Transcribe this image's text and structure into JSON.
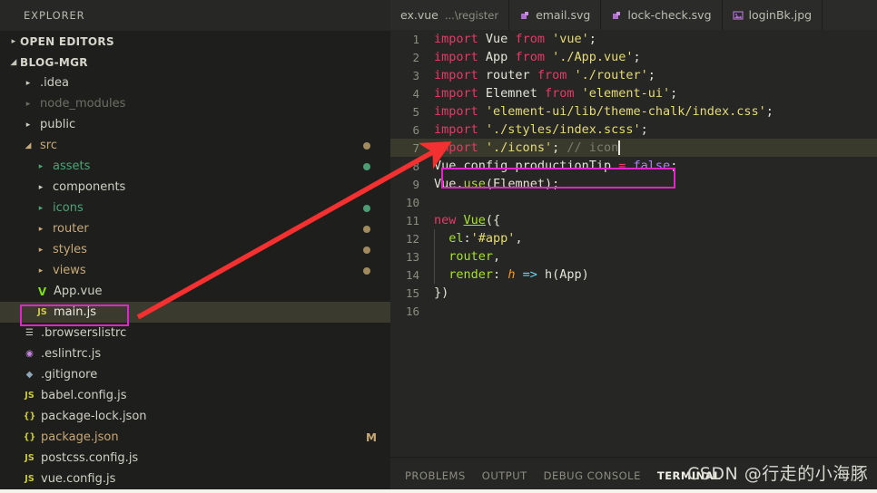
{
  "sidebar": {
    "title": "EXPLORER",
    "sections": [
      {
        "label": "OPEN EDITORS",
        "expanded": false
      },
      {
        "label": "BLOG-MGR",
        "expanded": true
      }
    ],
    "tree": [
      {
        "label": ".idea",
        "icon": "folder-collapsed-icon",
        "icon_glyph": "▸",
        "kind": "folder",
        "indent": 1,
        "color": "#cfcfc4",
        "dot": "",
        "badge": ""
      },
      {
        "label": "node_modules",
        "icon": "folder-collapsed-icon",
        "icon_glyph": "▸",
        "kind": "folder",
        "indent": 1,
        "color": "#6e6e64",
        "dot": "",
        "badge": ""
      },
      {
        "label": "public",
        "icon": "folder-collapsed-icon",
        "icon_glyph": "▸",
        "kind": "folder",
        "indent": 1,
        "color": "#cfcfc4",
        "dot": "",
        "badge": ""
      },
      {
        "label": "src",
        "icon": "folder-expanded-icon",
        "icon_glyph": "◢",
        "kind": "folder",
        "indent": 1,
        "color": "#c8a977",
        "dot": "#a08a5e",
        "badge": ""
      },
      {
        "label": "assets",
        "icon": "folder-collapsed-icon",
        "icon_glyph": "▸",
        "kind": "folder",
        "indent": 2,
        "color": "#4ea377",
        "dot": "#4d9d74",
        "badge": ""
      },
      {
        "label": "components",
        "icon": "folder-collapsed-icon",
        "icon_glyph": "▸",
        "kind": "folder",
        "indent": 2,
        "color": "#cfcfc4",
        "dot": "",
        "badge": ""
      },
      {
        "label": "icons",
        "icon": "folder-collapsed-icon",
        "icon_glyph": "▸",
        "kind": "folder",
        "indent": 2,
        "color": "#4ea377",
        "dot": "#4d9d74",
        "badge": ""
      },
      {
        "label": "router",
        "icon": "folder-collapsed-icon",
        "icon_glyph": "▸",
        "kind": "folder",
        "indent": 2,
        "color": "#c8a977",
        "dot": "#a08a5e",
        "badge": ""
      },
      {
        "label": "styles",
        "icon": "folder-collapsed-icon",
        "icon_glyph": "▸",
        "kind": "folder",
        "indent": 2,
        "color": "#c8a977",
        "dot": "#a08a5e",
        "badge": ""
      },
      {
        "label": "views",
        "icon": "folder-collapsed-icon",
        "icon_glyph": "▸",
        "kind": "folder",
        "indent": 2,
        "color": "#c8a977",
        "dot": "#a08a5e",
        "badge": ""
      },
      {
        "label": "App.vue",
        "icon": "vue-file-icon",
        "icon_glyph": "V",
        "kind": "file",
        "indent": 2,
        "color": "#cfcfc4",
        "dot": "",
        "badge": "",
        "icon_color": "#7ddc1f"
      },
      {
        "label": "main.js",
        "icon": "js-file-icon",
        "icon_glyph": "JS",
        "kind": "file",
        "indent": 2,
        "color": "#e8e8e0",
        "dot": "",
        "badge": "",
        "icon_color": "#cbcb41",
        "selected": true
      },
      {
        "label": ".browserslistrc",
        "icon": "config-file-icon",
        "icon_glyph": "☰",
        "kind": "file",
        "indent": 1,
        "color": "#cfcfc4",
        "dot": "",
        "badge": "",
        "icon_color": "#d4d4c8"
      },
      {
        "label": ".eslintrc.js",
        "icon": "eslint-file-icon",
        "icon_glyph": "◉",
        "kind": "file",
        "indent": 1,
        "color": "#cfcfc4",
        "dot": "",
        "badge": "",
        "icon_color": "#c586e0"
      },
      {
        "label": ".gitignore",
        "icon": "git-file-icon",
        "icon_glyph": "◆",
        "kind": "file",
        "indent": 1,
        "color": "#cfcfc4",
        "dot": "",
        "badge": "",
        "icon_color": "#8fa6b5"
      },
      {
        "label": "babel.config.js",
        "icon": "js-file-icon",
        "icon_glyph": "JS",
        "kind": "file",
        "indent": 1,
        "color": "#cfcfc4",
        "dot": "",
        "badge": "",
        "icon_color": "#cbcb41"
      },
      {
        "label": "package-lock.json",
        "icon": "json-file-icon",
        "icon_glyph": "{}",
        "kind": "file",
        "indent": 1,
        "color": "#cfcfc4",
        "dot": "",
        "badge": "",
        "icon_color": "#cbcb41"
      },
      {
        "label": "package.json",
        "icon": "json-file-icon",
        "icon_glyph": "{}",
        "kind": "file",
        "indent": 1,
        "color": "#c8a977",
        "dot": "",
        "badge": "M",
        "badge_color": "#c8a977",
        "icon_color": "#cbcb41"
      },
      {
        "label": "postcss.config.js",
        "icon": "js-file-icon",
        "icon_glyph": "JS",
        "kind": "file",
        "indent": 1,
        "color": "#cfcfc4",
        "dot": "",
        "badge": "",
        "icon_color": "#cbcb41"
      },
      {
        "label": "vue.config.js",
        "icon": "js-file-icon",
        "icon_glyph": "JS",
        "kind": "file",
        "indent": 1,
        "color": "#cfcfc4",
        "dot": "",
        "badge": "",
        "icon_color": "#cbcb41"
      }
    ]
  },
  "tabs": [
    {
      "label": "ex.vue",
      "desc": "...\\register",
      "icon": "vue-file-icon",
      "icon_glyph": "",
      "active": false
    },
    {
      "label": "email.svg",
      "desc": "",
      "icon": "svg-file-icon",
      "icon_glyph": "",
      "active": false
    },
    {
      "label": "lock-check.svg",
      "desc": "",
      "icon": "svg-file-icon",
      "icon_glyph": "",
      "active": false
    },
    {
      "label": "loginBk.jpg",
      "desc": "",
      "icon": "image-file-icon",
      "icon_glyph": "",
      "active": false
    }
  ],
  "code": {
    "lines": [
      {
        "n": "1",
        "tokens": [
          {
            "t": "kw",
            "v": "import"
          },
          {
            "t": "plain",
            "v": " "
          },
          {
            "t": "var",
            "v": "Vue"
          },
          {
            "t": "plain",
            "v": " "
          },
          {
            "t": "kw",
            "v": "from"
          },
          {
            "t": "plain",
            "v": " "
          },
          {
            "t": "str",
            "v": "'vue'"
          },
          {
            "t": "plain",
            "v": ";"
          }
        ]
      },
      {
        "n": "2",
        "tokens": [
          {
            "t": "kw",
            "v": "import"
          },
          {
            "t": "plain",
            "v": " "
          },
          {
            "t": "var",
            "v": "App"
          },
          {
            "t": "plain",
            "v": " "
          },
          {
            "t": "kw",
            "v": "from"
          },
          {
            "t": "plain",
            "v": " "
          },
          {
            "t": "str",
            "v": "'./App.vue'"
          },
          {
            "t": "plain",
            "v": ";"
          }
        ]
      },
      {
        "n": "3",
        "tokens": [
          {
            "t": "kw",
            "v": "import"
          },
          {
            "t": "plain",
            "v": " "
          },
          {
            "t": "var",
            "v": "router"
          },
          {
            "t": "plain",
            "v": " "
          },
          {
            "t": "kw",
            "v": "from"
          },
          {
            "t": "plain",
            "v": " "
          },
          {
            "t": "str",
            "v": "'./router'"
          },
          {
            "t": "plain",
            "v": ";"
          }
        ]
      },
      {
        "n": "4",
        "tokens": [
          {
            "t": "kw",
            "v": "import"
          },
          {
            "t": "plain",
            "v": " "
          },
          {
            "t": "var",
            "v": "Elemnet"
          },
          {
            "t": "plain",
            "v": " "
          },
          {
            "t": "kw",
            "v": "from"
          },
          {
            "t": "plain",
            "v": " "
          },
          {
            "t": "str",
            "v": "'element-ui'"
          },
          {
            "t": "plain",
            "v": ";"
          }
        ]
      },
      {
        "n": "5",
        "tokens": [
          {
            "t": "kw",
            "v": "import"
          },
          {
            "t": "plain",
            "v": " "
          },
          {
            "t": "str",
            "v": "'element-ui/lib/theme-chalk/index.css'"
          },
          {
            "t": "plain",
            "v": ";"
          }
        ]
      },
      {
        "n": "6",
        "tokens": [
          {
            "t": "kw",
            "v": "import"
          },
          {
            "t": "plain",
            "v": " "
          },
          {
            "t": "str",
            "v": "'./styles/index.scss'"
          },
          {
            "t": "plain",
            "v": ";"
          }
        ]
      },
      {
        "n": "7",
        "tokens": [
          {
            "t": "kw",
            "v": "import"
          },
          {
            "t": "plain",
            "v": " "
          },
          {
            "t": "str",
            "v": "'./icons'"
          },
          {
            "t": "plain",
            "v": "; "
          },
          {
            "t": "com",
            "v": "// icon"
          }
        ],
        "active": true,
        "cursor": true
      },
      {
        "n": "8",
        "tokens": [
          {
            "t": "var",
            "v": "Vue"
          },
          {
            "t": "plain",
            "v": "."
          },
          {
            "t": "var",
            "v": "config"
          },
          {
            "t": "plain",
            "v": "."
          },
          {
            "t": "var",
            "v": "productionTip"
          },
          {
            "t": "plain",
            "v": " "
          },
          {
            "t": "op",
            "v": "="
          },
          {
            "t": "plain",
            "v": " "
          },
          {
            "t": "num",
            "v": "false"
          },
          {
            "t": "plain",
            "v": ";"
          }
        ]
      },
      {
        "n": "9",
        "tokens": [
          {
            "t": "var",
            "v": "Vue"
          },
          {
            "t": "plain",
            "v": "."
          },
          {
            "t": "fn",
            "v": "use"
          },
          {
            "t": "plain",
            "v": "("
          },
          {
            "t": "var",
            "v": "Elemnet"
          },
          {
            "t": "plain",
            "v": ");"
          }
        ]
      },
      {
        "n": "10",
        "tokens": []
      },
      {
        "n": "11",
        "tokens": [
          {
            "t": "kw",
            "v": "new"
          },
          {
            "t": "plain",
            "v": " "
          },
          {
            "t": "cls",
            "v": "Vue"
          },
          {
            "t": "plain",
            "v": "({"
          }
        ]
      },
      {
        "n": "12",
        "tokens": [
          {
            "t": "plain",
            "v": "  "
          },
          {
            "t": "prop",
            "v": "el"
          },
          {
            "t": "plain",
            "v": ":"
          },
          {
            "t": "str",
            "v": "'#app'"
          },
          {
            "t": "plain",
            "v": ","
          }
        ],
        "guide": true
      },
      {
        "n": "13",
        "tokens": [
          {
            "t": "plain",
            "v": "  "
          },
          {
            "t": "prop",
            "v": "router"
          },
          {
            "t": "plain",
            "v": ","
          }
        ],
        "guide": true
      },
      {
        "n": "14",
        "tokens": [
          {
            "t": "plain",
            "v": "  "
          },
          {
            "t": "prop",
            "v": "render"
          },
          {
            "t": "plain",
            "v": ": "
          },
          {
            "t": "param",
            "v": "h"
          },
          {
            "t": "plain",
            "v": " "
          },
          {
            "t": "arrow",
            "v": "=>"
          },
          {
            "t": "plain",
            "v": " "
          },
          {
            "t": "var",
            "v": "h"
          },
          {
            "t": "plain",
            "v": "("
          },
          {
            "t": "var",
            "v": "App"
          },
          {
            "t": "plain",
            "v": ")"
          }
        ],
        "guide": true
      },
      {
        "n": "15",
        "tokens": [
          {
            "t": "plain",
            "v": "})"
          }
        ]
      },
      {
        "n": "16",
        "tokens": []
      }
    ]
  },
  "panel": {
    "tabs": [
      {
        "label": "PROBLEMS",
        "active": false
      },
      {
        "label": "OUTPUT",
        "active": false
      },
      {
        "label": "DEBUG CONSOLE",
        "active": false
      },
      {
        "label": "TERMINAL",
        "active": true
      }
    ]
  },
  "watermark": {
    "text": "CSDN @行走的小海豚"
  },
  "annotations": {
    "highlight_color": "#e324c8",
    "arrow_color": "#f53030",
    "highlighted_file": "main.js",
    "highlighted_code_line": "7"
  }
}
